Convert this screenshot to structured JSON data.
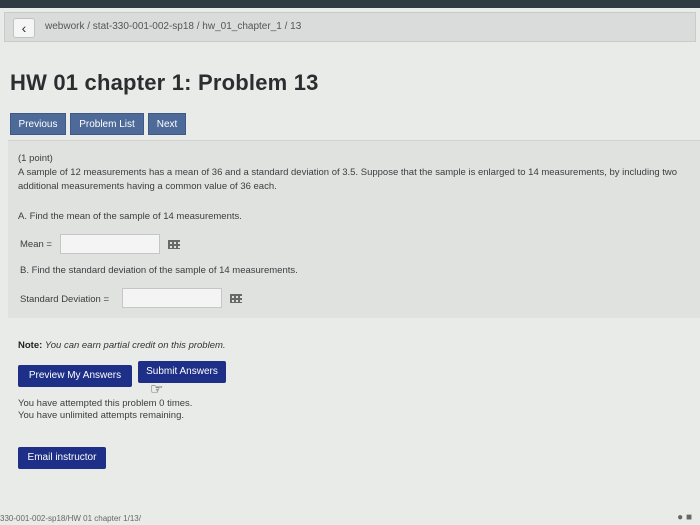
{
  "breadcrumb": {
    "text": "webwork / stat-330-001-002-sp18 / hw_01_chapter_1 / 13"
  },
  "page": {
    "title": "HW 01 chapter 1: Problem 13"
  },
  "nav": {
    "previous": "Previous",
    "problem_list": "Problem List",
    "next": "Next"
  },
  "problem": {
    "points": "(1 point)",
    "statement_line1": "A sample of 12 measurements has a mean of 36 and a standard deviation of 3.5. Suppose that the sample is enlarged to 14 measurements, by including two",
    "statement_line2": "additional measurements having a common value of 36 each.",
    "part_a": "A. Find the mean of the sample of 14 measurements.",
    "mean_label": "Mean =",
    "mean_value": "",
    "part_b": "B. Find the standard deviation of the sample of 14 measurements.",
    "sd_label": "Standard Deviation =",
    "sd_value": ""
  },
  "note": {
    "label": "Note:",
    "text": "You can earn partial credit on this problem."
  },
  "actions": {
    "preview": "Preview My Answers",
    "submit": "Submit Answers",
    "email": "Email instructor"
  },
  "attempts": {
    "line1": "You have attempted this problem 0 times.",
    "line2": "You have unlimited attempts remaining."
  },
  "status_url": "330-001-002-sp18/HW 01 chapter 1/13/",
  "icons": {
    "back": "chevron-left-icon",
    "answer_grid": "grid-icon",
    "cursor": "pointer-cursor-icon"
  }
}
